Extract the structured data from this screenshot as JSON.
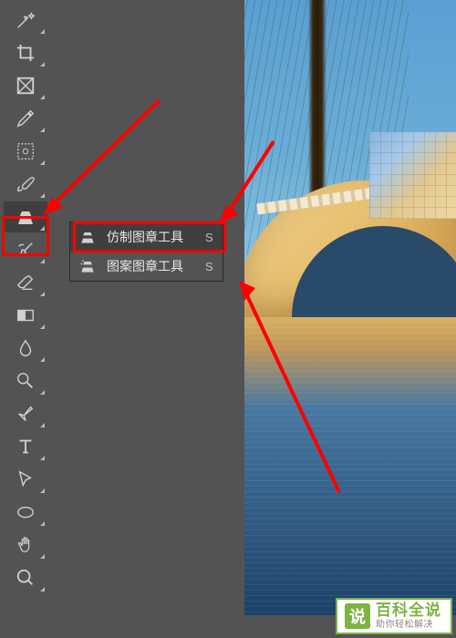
{
  "toolbar": {
    "tools": [
      {
        "name": "magic-wand",
        "selected": false
      },
      {
        "name": "crop",
        "selected": false
      },
      {
        "name": "frame",
        "selected": false
      },
      {
        "name": "eyedropper",
        "selected": false
      },
      {
        "name": "spot-heal",
        "selected": false
      },
      {
        "name": "brush",
        "selected": false
      },
      {
        "name": "clone-stamp",
        "selected": true
      },
      {
        "name": "history-brush",
        "selected": false
      },
      {
        "name": "eraser",
        "selected": false
      },
      {
        "name": "gradient",
        "selected": false
      },
      {
        "name": "blur",
        "selected": false
      },
      {
        "name": "dodge",
        "selected": false
      },
      {
        "name": "pen",
        "selected": false
      },
      {
        "name": "text",
        "selected": false
      },
      {
        "name": "path-select",
        "selected": false
      },
      {
        "name": "ellipse",
        "selected": false
      },
      {
        "name": "hand",
        "selected": false
      },
      {
        "name": "zoom",
        "selected": false
      }
    ]
  },
  "context_menu": {
    "items": [
      {
        "icon": "clone-stamp",
        "label": "仿制图章工具",
        "shortcut": "S",
        "active": true
      },
      {
        "icon": "pattern-stamp",
        "label": "图案图章工具",
        "shortcut": "S",
        "active": false
      }
    ]
  },
  "watermark": {
    "logo_char": "说",
    "title": "百科全说",
    "subtitle": "助你轻松解决"
  },
  "annotations": {
    "highlight_tool": "clone-stamp",
    "highlight_menu_item": 0
  }
}
